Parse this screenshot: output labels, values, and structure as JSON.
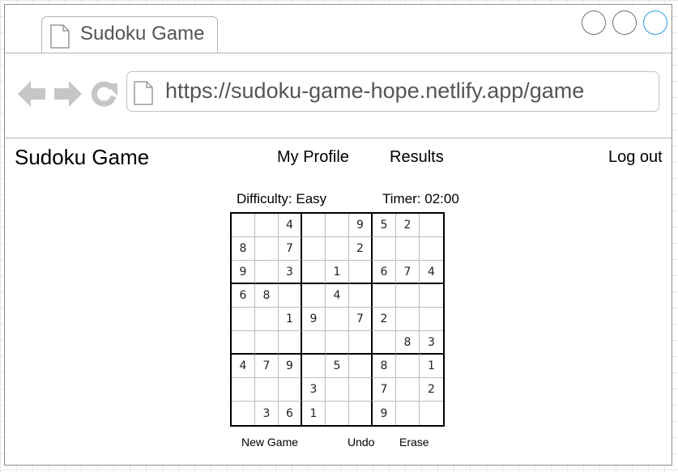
{
  "browser": {
    "tab_title": "Sudoku Game",
    "url": "https://sudoku-game-hope.netlify.app/game"
  },
  "app": {
    "title": "Sudoku Game",
    "nav": {
      "profile": "My Profile",
      "results": "Results",
      "logout": "Log out"
    }
  },
  "game": {
    "difficulty": "Difficulty: Easy",
    "timer": "Timer: 02:00",
    "board": [
      [
        "",
        "",
        "4",
        "",
        "",
        "9",
        "5",
        "2",
        ""
      ],
      [
        "8",
        "",
        "7",
        "",
        "",
        "2",
        "",
        "",
        ""
      ],
      [
        "9",
        "",
        "3",
        "",
        "1",
        "",
        "6",
        "7",
        "4"
      ],
      [
        "6",
        "8",
        "",
        "",
        "4",
        "",
        "",
        "",
        ""
      ],
      [
        "",
        "",
        "1",
        "9",
        "",
        "7",
        "2",
        "",
        ""
      ],
      [
        "",
        "",
        "",
        "",
        "",
        "",
        "",
        "8",
        "3"
      ],
      [
        "4",
        "7",
        "9",
        "",
        "5",
        "",
        "8",
        "",
        "1"
      ],
      [
        "",
        "",
        "",
        "3",
        "",
        "",
        "7",
        "",
        "2"
      ],
      [
        "",
        "3",
        "6",
        "1",
        "",
        "",
        "9",
        "",
        ""
      ]
    ],
    "actions": {
      "new_game": "New Game",
      "undo": "Undo",
      "erase": "Erase"
    }
  },
  "colors": {
    "maximize_accent": "#2c9ae2",
    "nav_icon": "#c6c6c6"
  },
  "icons": [
    "page-icon",
    "back-arrow-icon",
    "forward-arrow-icon",
    "reload-icon"
  ]
}
